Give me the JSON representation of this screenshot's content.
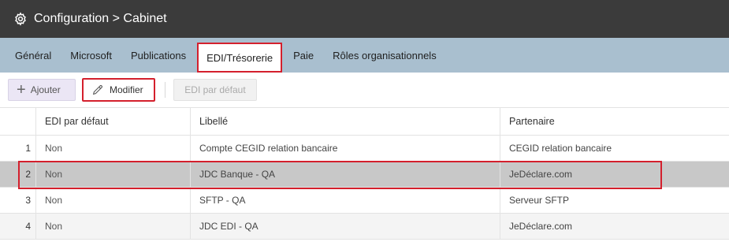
{
  "title": {
    "icon": "gear-icon",
    "text": "Configuration > Cabinet"
  },
  "tabs": [
    {
      "label": "Général",
      "active": false
    },
    {
      "label": "Microsoft",
      "active": false
    },
    {
      "label": "Publications",
      "active": false
    },
    {
      "label": "EDI/Trésorerie",
      "active": true
    },
    {
      "label": "Paie",
      "active": false
    },
    {
      "label": "Rôles organisationnels",
      "active": false
    }
  ],
  "toolbar": {
    "add_label": "Ajouter",
    "edit_label": "Modifier",
    "default_label": "EDI par défaut"
  },
  "table": {
    "columns": [
      "EDI par défaut",
      "Libellé",
      "Partenaire"
    ],
    "rows": [
      {
        "num": "1",
        "edi": "Non",
        "libelle": "Compte CEGID relation bancaire",
        "partenaire": "CEGID relation bancaire"
      },
      {
        "num": "2",
        "edi": "Non",
        "libelle": "JDC Banque - QA",
        "partenaire": "JeDéclare.com",
        "selected": true
      },
      {
        "num": "3",
        "edi": "Non",
        "libelle": "SFTP - QA",
        "partenaire": "Serveur SFTP"
      },
      {
        "num": "4",
        "edi": "Non",
        "libelle": "JDC EDI - QA",
        "partenaire": "JeDéclare.com"
      }
    ]
  },
  "colors": {
    "titlebar": "#3b3b3b",
    "tabbar": "#a9bfcf",
    "highlight": "#d4202d",
    "selected_row": "#c8c8c8"
  }
}
